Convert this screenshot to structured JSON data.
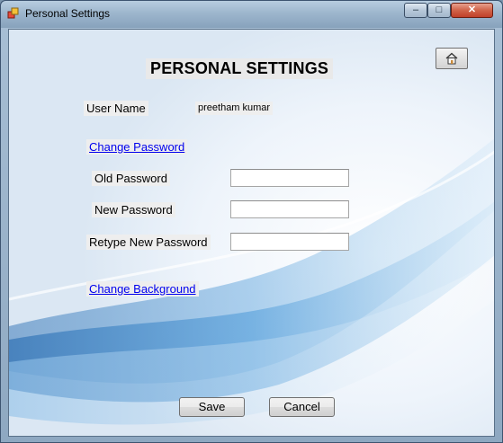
{
  "window": {
    "title": "Personal Settings",
    "controls": {
      "minimize": "–",
      "maximize": "□",
      "close": "✕"
    }
  },
  "form": {
    "heading": "PERSONAL SETTINGS",
    "home_icon": "home-icon",
    "user_name_label": "User Name",
    "user_name_value": "preetham kumar",
    "change_password_link": "Change Password",
    "old_password_label": "Old Password",
    "old_password_value": "",
    "new_password_label": "New Password",
    "new_password_value": "",
    "retype_password_label": "Retype New Password",
    "retype_password_value": "",
    "change_background_link": "Change Background",
    "save_label": "Save",
    "cancel_label": "Cancel"
  },
  "colors": {
    "link": "#0000ee",
    "background_wave": "#3f86c4",
    "label_bg": "#eeeeee"
  }
}
